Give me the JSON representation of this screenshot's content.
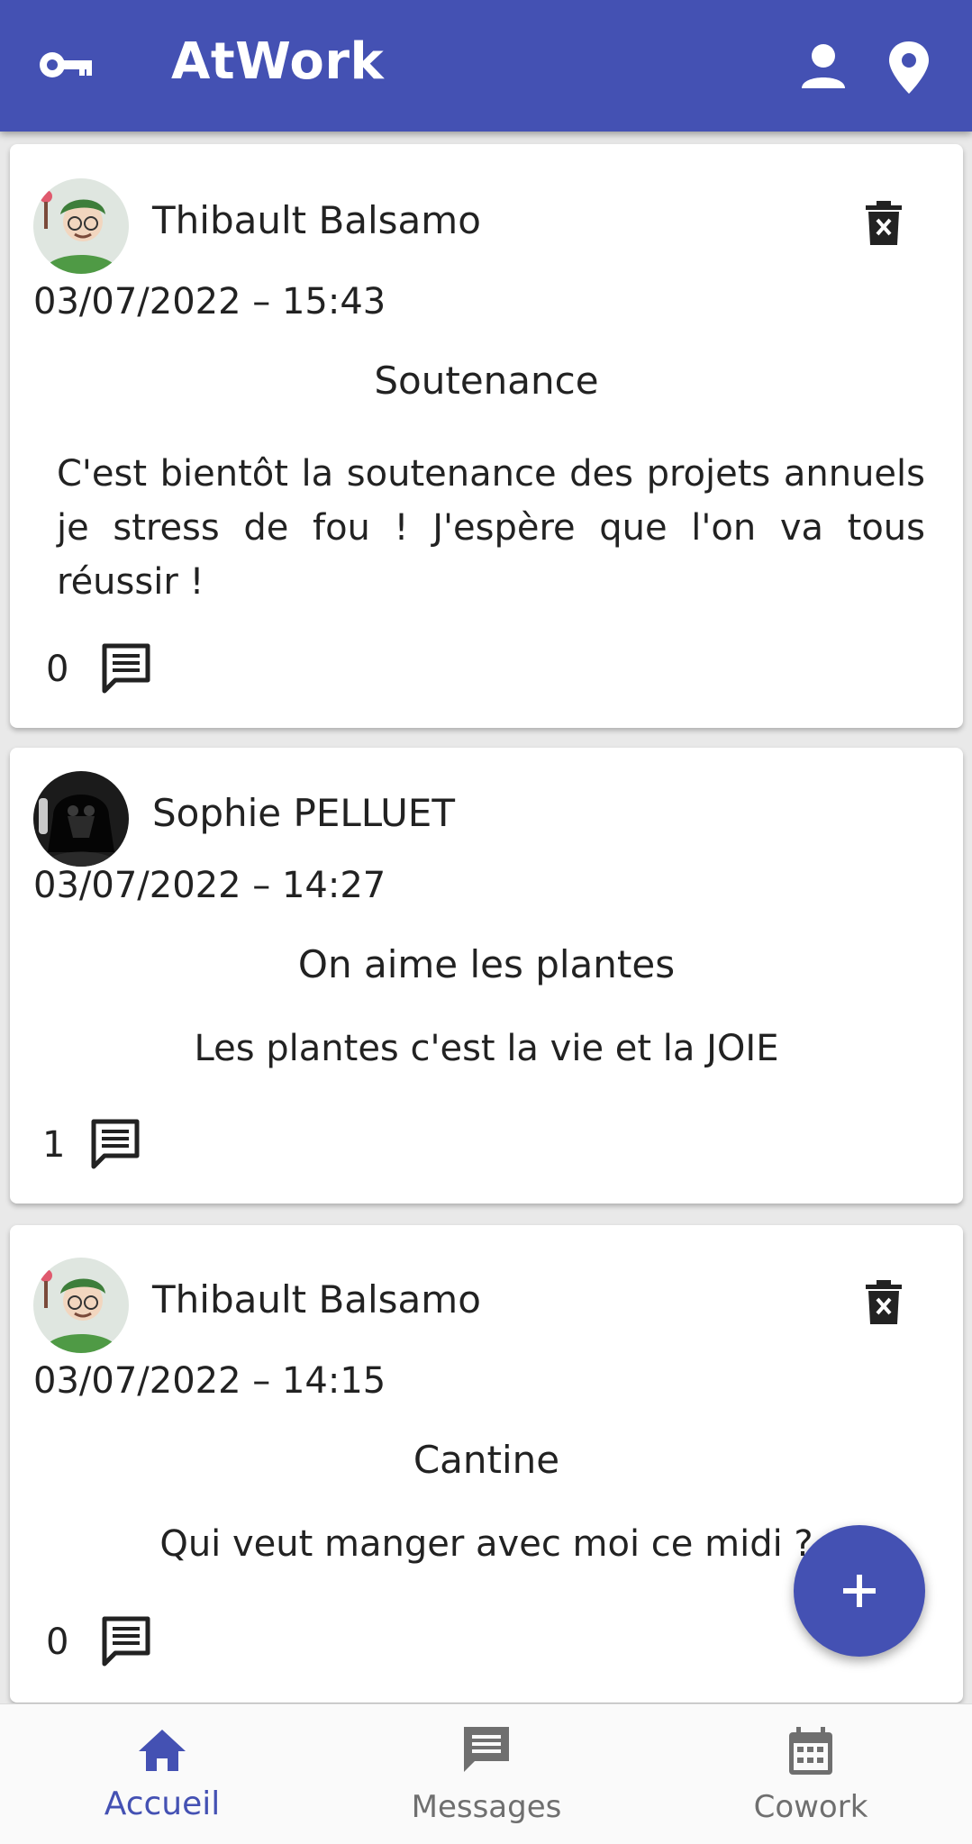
{
  "app": {
    "title": "AtWork",
    "primary_color": "#4451b3"
  },
  "header": {
    "left_icon": "key-icon",
    "right_icons": [
      "person-icon",
      "location-pin-icon"
    ]
  },
  "posts": [
    {
      "author": "Thibault Balsamo",
      "date": "03/07/2022 – 15:43",
      "title": "Soutenance",
      "body": "C'est bientôt la soutenance des projets annuels je stress de fou ! J'espère que l'on va tous réussir !",
      "comments": "0",
      "can_delete": true
    },
    {
      "author": "Sophie PELLUET",
      "date": "03/07/2022 – 14:27",
      "title": "On aime les plantes",
      "body": "Les plantes c'est la vie et la JOIE",
      "comments": "1",
      "can_delete": false
    },
    {
      "author": "Thibault Balsamo",
      "date": "03/07/2022 – 14:15",
      "title": "Cantine",
      "body": "Qui veut manger avec moi ce midi ?",
      "comments": "0",
      "can_delete": true
    }
  ],
  "fab": {
    "icon": "plus-icon"
  },
  "bottom_nav": {
    "items": [
      {
        "label": "Accueil",
        "icon": "home-icon",
        "active": true
      },
      {
        "label": "Messages",
        "icon": "message-icon",
        "active": false
      },
      {
        "label": "Cowork",
        "icon": "calendar-icon",
        "active": false
      }
    ],
    "active_color": "#4451b3",
    "inactive_color": "#6f6f6f"
  }
}
